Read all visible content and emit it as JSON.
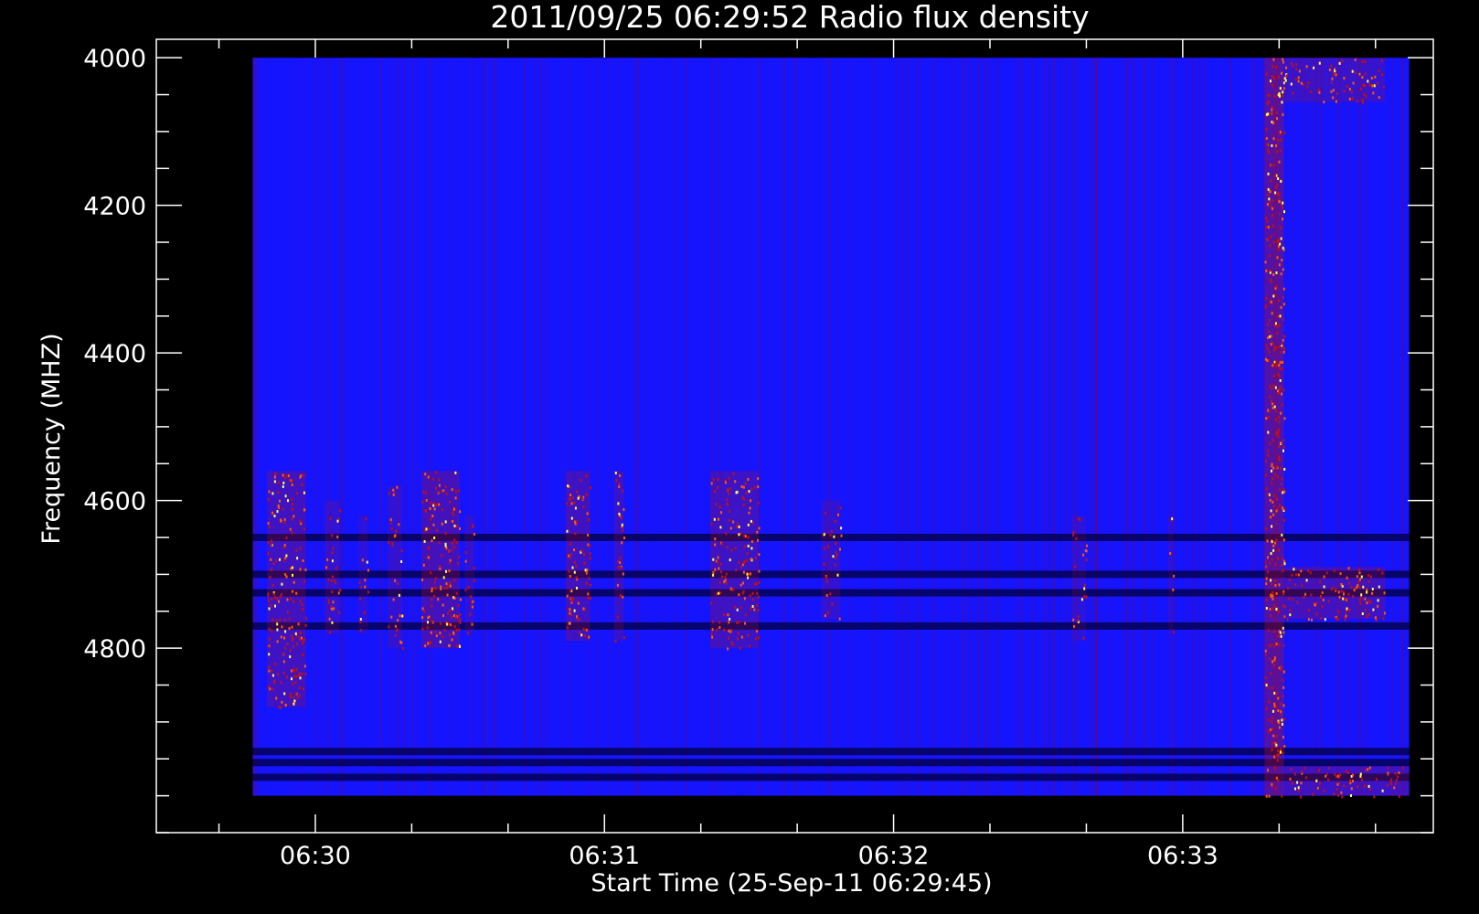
{
  "chart_data": {
    "type": "heatmap",
    "title": "2011/09/25 06:29:52 Radio flux density",
    "xlabel": "Start Time (25-Sep-11 06:29:45)",
    "ylabel": "Frequency (MHZ)",
    "x_start": "06:29:45",
    "x_range_seconds": [
      -18,
      247
    ],
    "data_x_extent_seconds": [
      2,
      242
    ],
    "ylim": [
      5050,
      3975
    ],
    "data_y_extent_mhz": [
      4000,
      5000
    ],
    "y_inverted": true,
    "x_ticks": [
      "06:30",
      "06:31",
      "06:32",
      "06:33"
    ],
    "x_tick_seconds": [
      15,
      75,
      135,
      195
    ],
    "x_minor_step_seconds": 20,
    "y_ticks": [
      4000,
      4200,
      4400,
      4600,
      4800
    ],
    "y_minor_step_mhz": 50,
    "colormap": [
      "#000000",
      "#1414ff",
      "#c01010",
      "#ff5a00",
      "#ffff50"
    ],
    "background_color": "#1414ff",
    "bursts": [
      {
        "t": [
          5,
          13
        ],
        "f": [
          4560,
          4880
        ],
        "intensity": 0.55
      },
      {
        "t": [
          17,
          20
        ],
        "f": [
          4600,
          4780
        ],
        "intensity": 0.4
      },
      {
        "t": [
          24,
          26
        ],
        "f": [
          4620,
          4780
        ],
        "intensity": 0.3
      },
      {
        "t": [
          30,
          33
        ],
        "f": [
          4580,
          4800
        ],
        "intensity": 0.35
      },
      {
        "t": [
          37,
          45
        ],
        "f": [
          4560,
          4800
        ],
        "intensity": 0.6
      },
      {
        "t": [
          46,
          48
        ],
        "f": [
          4620,
          4780
        ],
        "intensity": 0.35
      },
      {
        "t": [
          67,
          72
        ],
        "f": [
          4560,
          4790
        ],
        "intensity": 0.55
      },
      {
        "t": [
          77,
          79
        ],
        "f": [
          4560,
          4790
        ],
        "intensity": 0.45
      },
      {
        "t": [
          97,
          107
        ],
        "f": [
          4560,
          4800
        ],
        "intensity": 0.5
      },
      {
        "t": [
          120,
          124
        ],
        "f": [
          4600,
          4760
        ],
        "intensity": 0.35
      },
      {
        "t": [
          172,
          175
        ],
        "f": [
          4620,
          4790
        ],
        "intensity": 0.3
      },
      {
        "t": [
          192,
          193
        ],
        "f": [
          4620,
          4780
        ],
        "intensity": 0.25
      },
      {
        "t": [
          212,
          216
        ],
        "f": [
          4000,
          5000
        ],
        "intensity": 0.75
      },
      {
        "t": [
          216,
          237
        ],
        "f": [
          4690,
          4760
        ],
        "intensity": 0.55
      },
      {
        "t": [
          216,
          237
        ],
        "f": [
          4000,
          4060
        ],
        "intensity": 0.45
      },
      {
        "t": [
          216,
          242
        ],
        "f": [
          4960,
          5000
        ],
        "intensity": 0.5
      }
    ],
    "dark_bands_mhz": [
      4650,
      4700,
      4725,
      4770,
      4940,
      4955,
      4975
    ]
  }
}
